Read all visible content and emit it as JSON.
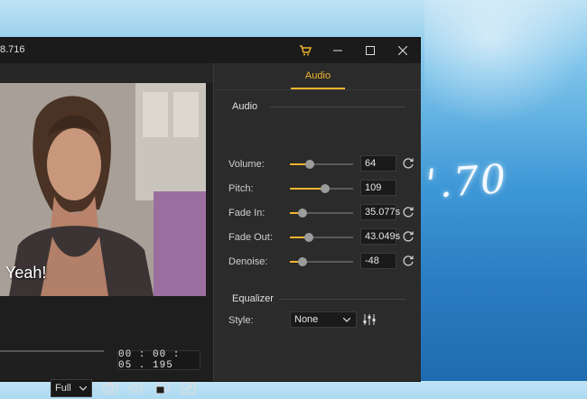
{
  "window": {
    "title": "8.716"
  },
  "player": {
    "subtitle": "Yeah!",
    "timecode": "00 : 00 : 05 . 195",
    "zoom_select": "Full"
  },
  "panel": {
    "tab": "Audio",
    "audio_section": "Audio",
    "controls": [
      {
        "label": "Volume:",
        "value": "64",
        "level": 0.32,
        "resettable": true
      },
      {
        "label": "Pitch:",
        "value": "109",
        "level": 0.55,
        "resettable": false
      },
      {
        "label": "Fade In:",
        "value": "35.077s",
        "level": 0.2,
        "resettable": true
      },
      {
        "label": "Fade Out:",
        "value": "43.049s",
        "level": 0.3,
        "resettable": true
      },
      {
        "label": "Denoise:",
        "value": "-48",
        "level": 0.2,
        "resettable": true
      }
    ],
    "equalizer_section": "Equalizer",
    "style_label": "Style:",
    "style_value": "None"
  },
  "colors": {
    "accent": "#f2b52e",
    "panel": "#2b2b2b",
    "window": "#232323"
  }
}
